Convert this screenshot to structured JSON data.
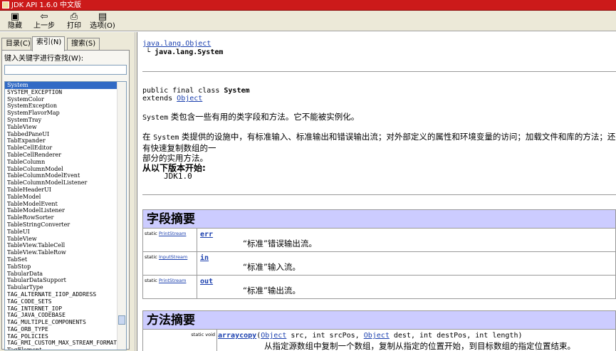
{
  "window": {
    "title": "JDK API 1.6.0 中文版"
  },
  "toolbar": {
    "hide": "隐藏",
    "back": "上一步",
    "print": "打印",
    "options": "选项(O)"
  },
  "left": {
    "tabs": [
      "目录(C)",
      "索引(N)",
      "搜索(S)"
    ],
    "active_tab": 1,
    "keyword_label": "键入关键字进行查找(W):",
    "keyword_value": "",
    "index_items": [
      "System",
      "SYSTEM_EXCEPTION",
      "SystemColor",
      "SystemException",
      "SystemFlavorMap",
      "SystemTray",
      "TableView",
      "TabbedPaneUI",
      "TabExpander",
      "TableCellEditor",
      "TableCellRenderer",
      "TableColumn",
      "TableColumnModel",
      "TableColumnModelEvent",
      "TableColumnModelListener",
      "TableHeaderUI",
      "TableModel",
      "TableModelEvent",
      "TableModelListener",
      "TableRowSorter",
      "TableStringConverter",
      "TableUI",
      "TableView",
      "TableView.TableCell",
      "TableView.TableRow",
      "TabSet",
      "TabStop",
      "TabularData",
      "TabularDataSupport",
      "TabularType",
      "TAG_ALTERNATE_IIOP_ADDRESS",
      "TAG_CODE_SETS",
      "TAG_INTERNET_IOP",
      "TAG_JAVA_CODEBASE",
      "TAG_MULTIPLE_COMPONENTS",
      "TAG_ORB_TYPE",
      "TAG_POLICIES",
      "TAG_RMI_CUSTOM_MAX_STREAM_FORMAT",
      "TagElement"
    ],
    "selected_index": 0
  },
  "content": {
    "package_link": "java.lang.Object",
    "tree_prefix": "└",
    "tree_class": "java.lang.System",
    "decl_line1": "public final class ",
    "decl_class": "System",
    "decl_extends": "extends ",
    "decl_parent": "Object",
    "para1_a": "System",
    "para1_b": " 类包含一些有用的类字段和方法。它不能被实例化。",
    "para2_a": "在 ",
    "para2_b": "System",
    "para2_c": " 类提供的设施中，有标准输入、标准输出和错误输出流；对外部定义的属性和环境变量的访问；加载文件和库的方法；还有快速复制数组的一",
    "para2_d": "部分的实用方法。",
    "since_label": "从以下版本开始:",
    "since_value": "JDK1.0",
    "field_summary_title": "字段摘要",
    "fields": [
      {
        "modifier": "static",
        "type": "PrintStream",
        "name": "err",
        "desc": "“标准”错误输出流。"
      },
      {
        "modifier": "static",
        "type": "InputStream",
        "name": "in",
        "desc": "“标准”输入流。"
      },
      {
        "modifier": "static",
        "type": "PrintStream",
        "name": "out",
        "desc": "“标准”输出流。"
      }
    ],
    "method_summary_title": "方法摘要",
    "method": {
      "modifier": "static void",
      "name": "arraycopy",
      "sig_open": "(",
      "p1_type": "Object",
      "p1_rest": " src, int srcPos, ",
      "p2_type": "Object",
      "p2_rest": " dest, int destPos, int length)",
      "desc": "从指定源数组中复制一个数组，复制从指定的位置开始，到目标数组的指定位置结束。"
    }
  },
  "colors": {
    "titlebar": "#cc1a1a",
    "section_header": "#ccccff",
    "link": "#1a3fae",
    "selection": "#316ac5"
  }
}
